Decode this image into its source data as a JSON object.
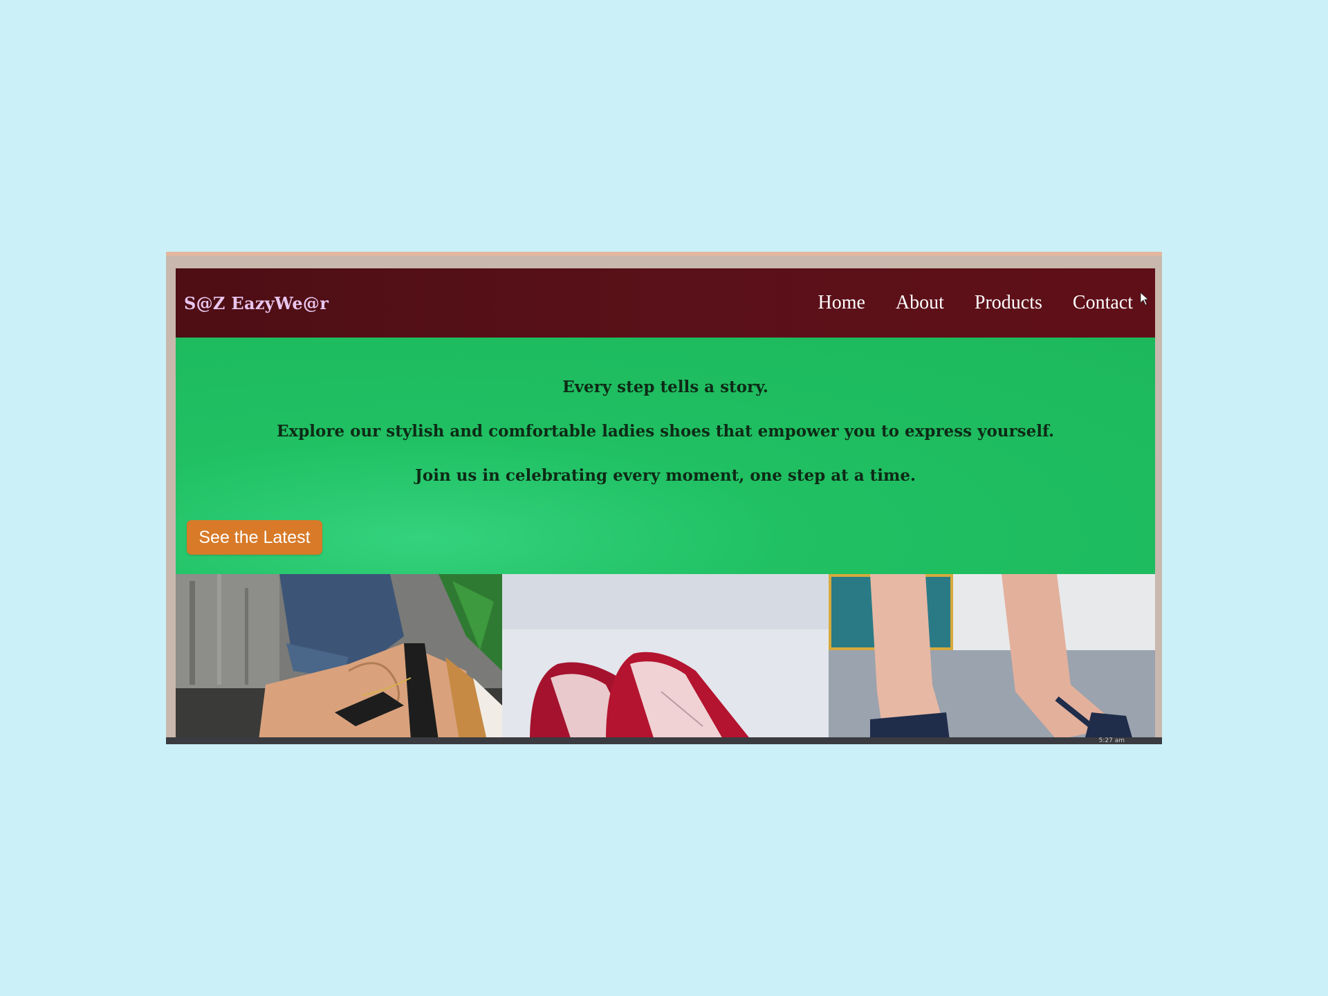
{
  "navbar": {
    "brand": "S@Z EazyWe@r",
    "links": [
      "Home",
      "About",
      "Products",
      "Contact"
    ]
  },
  "hero": {
    "line1": "Every step tells a story.",
    "line2": "Explore our stylish and comfortable ladies shoes that empower you to express yourself.",
    "line3": "Join us in celebrating every moment, one step at a time.",
    "cta_label": "See the Latest"
  },
  "gallery": {
    "images": [
      "sandal-photo",
      "red-flats-photo",
      "flip-flops-photo"
    ]
  },
  "taskbar": {
    "clock": "5:27 am"
  },
  "colors": {
    "background": "#cbf0f7",
    "navbar": "#5a1119",
    "hero": "#20c063",
    "button": "#d87a28"
  }
}
